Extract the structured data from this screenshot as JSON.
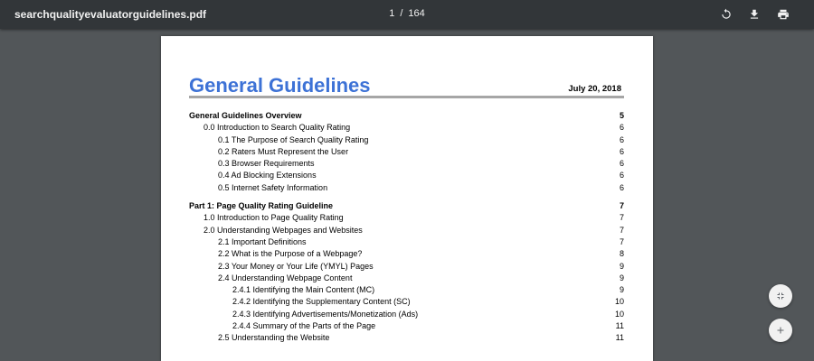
{
  "toolbar": {
    "file_name": "searchqualityevaluatorguidelines.pdf",
    "current_page": "1",
    "separator": "/",
    "total_pages": "164",
    "icons": [
      "rotate-icon",
      "download-icon",
      "print-icon"
    ]
  },
  "document": {
    "heading": "General Guidelines",
    "date": "July 20, 2018",
    "heading_color": "#3d72d6",
    "toc": [
      {
        "label": "General Guidelines Overview",
        "page": "5"
      },
      {
        "label": "0.0 Introduction to Search Quality Rating",
        "page": "6"
      },
      {
        "label": "0.1 The Purpose of Search Quality Rating",
        "page": "6"
      },
      {
        "label": "0.2 Raters Must Represent the User",
        "page": "6"
      },
      {
        "label": "0.3 Browser Requirements",
        "page": "6"
      },
      {
        "label": "0.4 Ad Blocking Extensions",
        "page": "6"
      },
      {
        "label": "0.5 Internet Safety Information",
        "page": "6"
      },
      {
        "label": "Part 1: Page Quality Rating Guideline",
        "page": "7"
      },
      {
        "label": "1.0 Introduction to Page Quality Rating",
        "page": "7"
      },
      {
        "label": "2.0 Understanding Webpages and Websites",
        "page": "7"
      },
      {
        "label": "2.1 Important Definitions",
        "page": "7"
      },
      {
        "label": "2.2 What is the Purpose of a Webpage?",
        "page": "8"
      },
      {
        "label": "2.3 Your Money or Your Life (YMYL) Pages",
        "page": "9"
      },
      {
        "label": "2.4 Understanding Webpage Content",
        "page": "9"
      },
      {
        "label": "2.4.1 Identifying the Main Content (MC)",
        "page": "9"
      },
      {
        "label": "2.4.2 Identifying the Supplementary Content (SC)",
        "page": "10"
      },
      {
        "label": "2.4.3 Identifying Advertisements/Monetization (Ads)",
        "page": "10"
      },
      {
        "label": "2.4.4 Summary of the Parts of the Page",
        "page": "11"
      },
      {
        "label": "2.5 Understanding the Website",
        "page": "11"
      }
    ]
  },
  "floating_buttons": [
    "fit-page-icon",
    "zoom-in-icon"
  ]
}
